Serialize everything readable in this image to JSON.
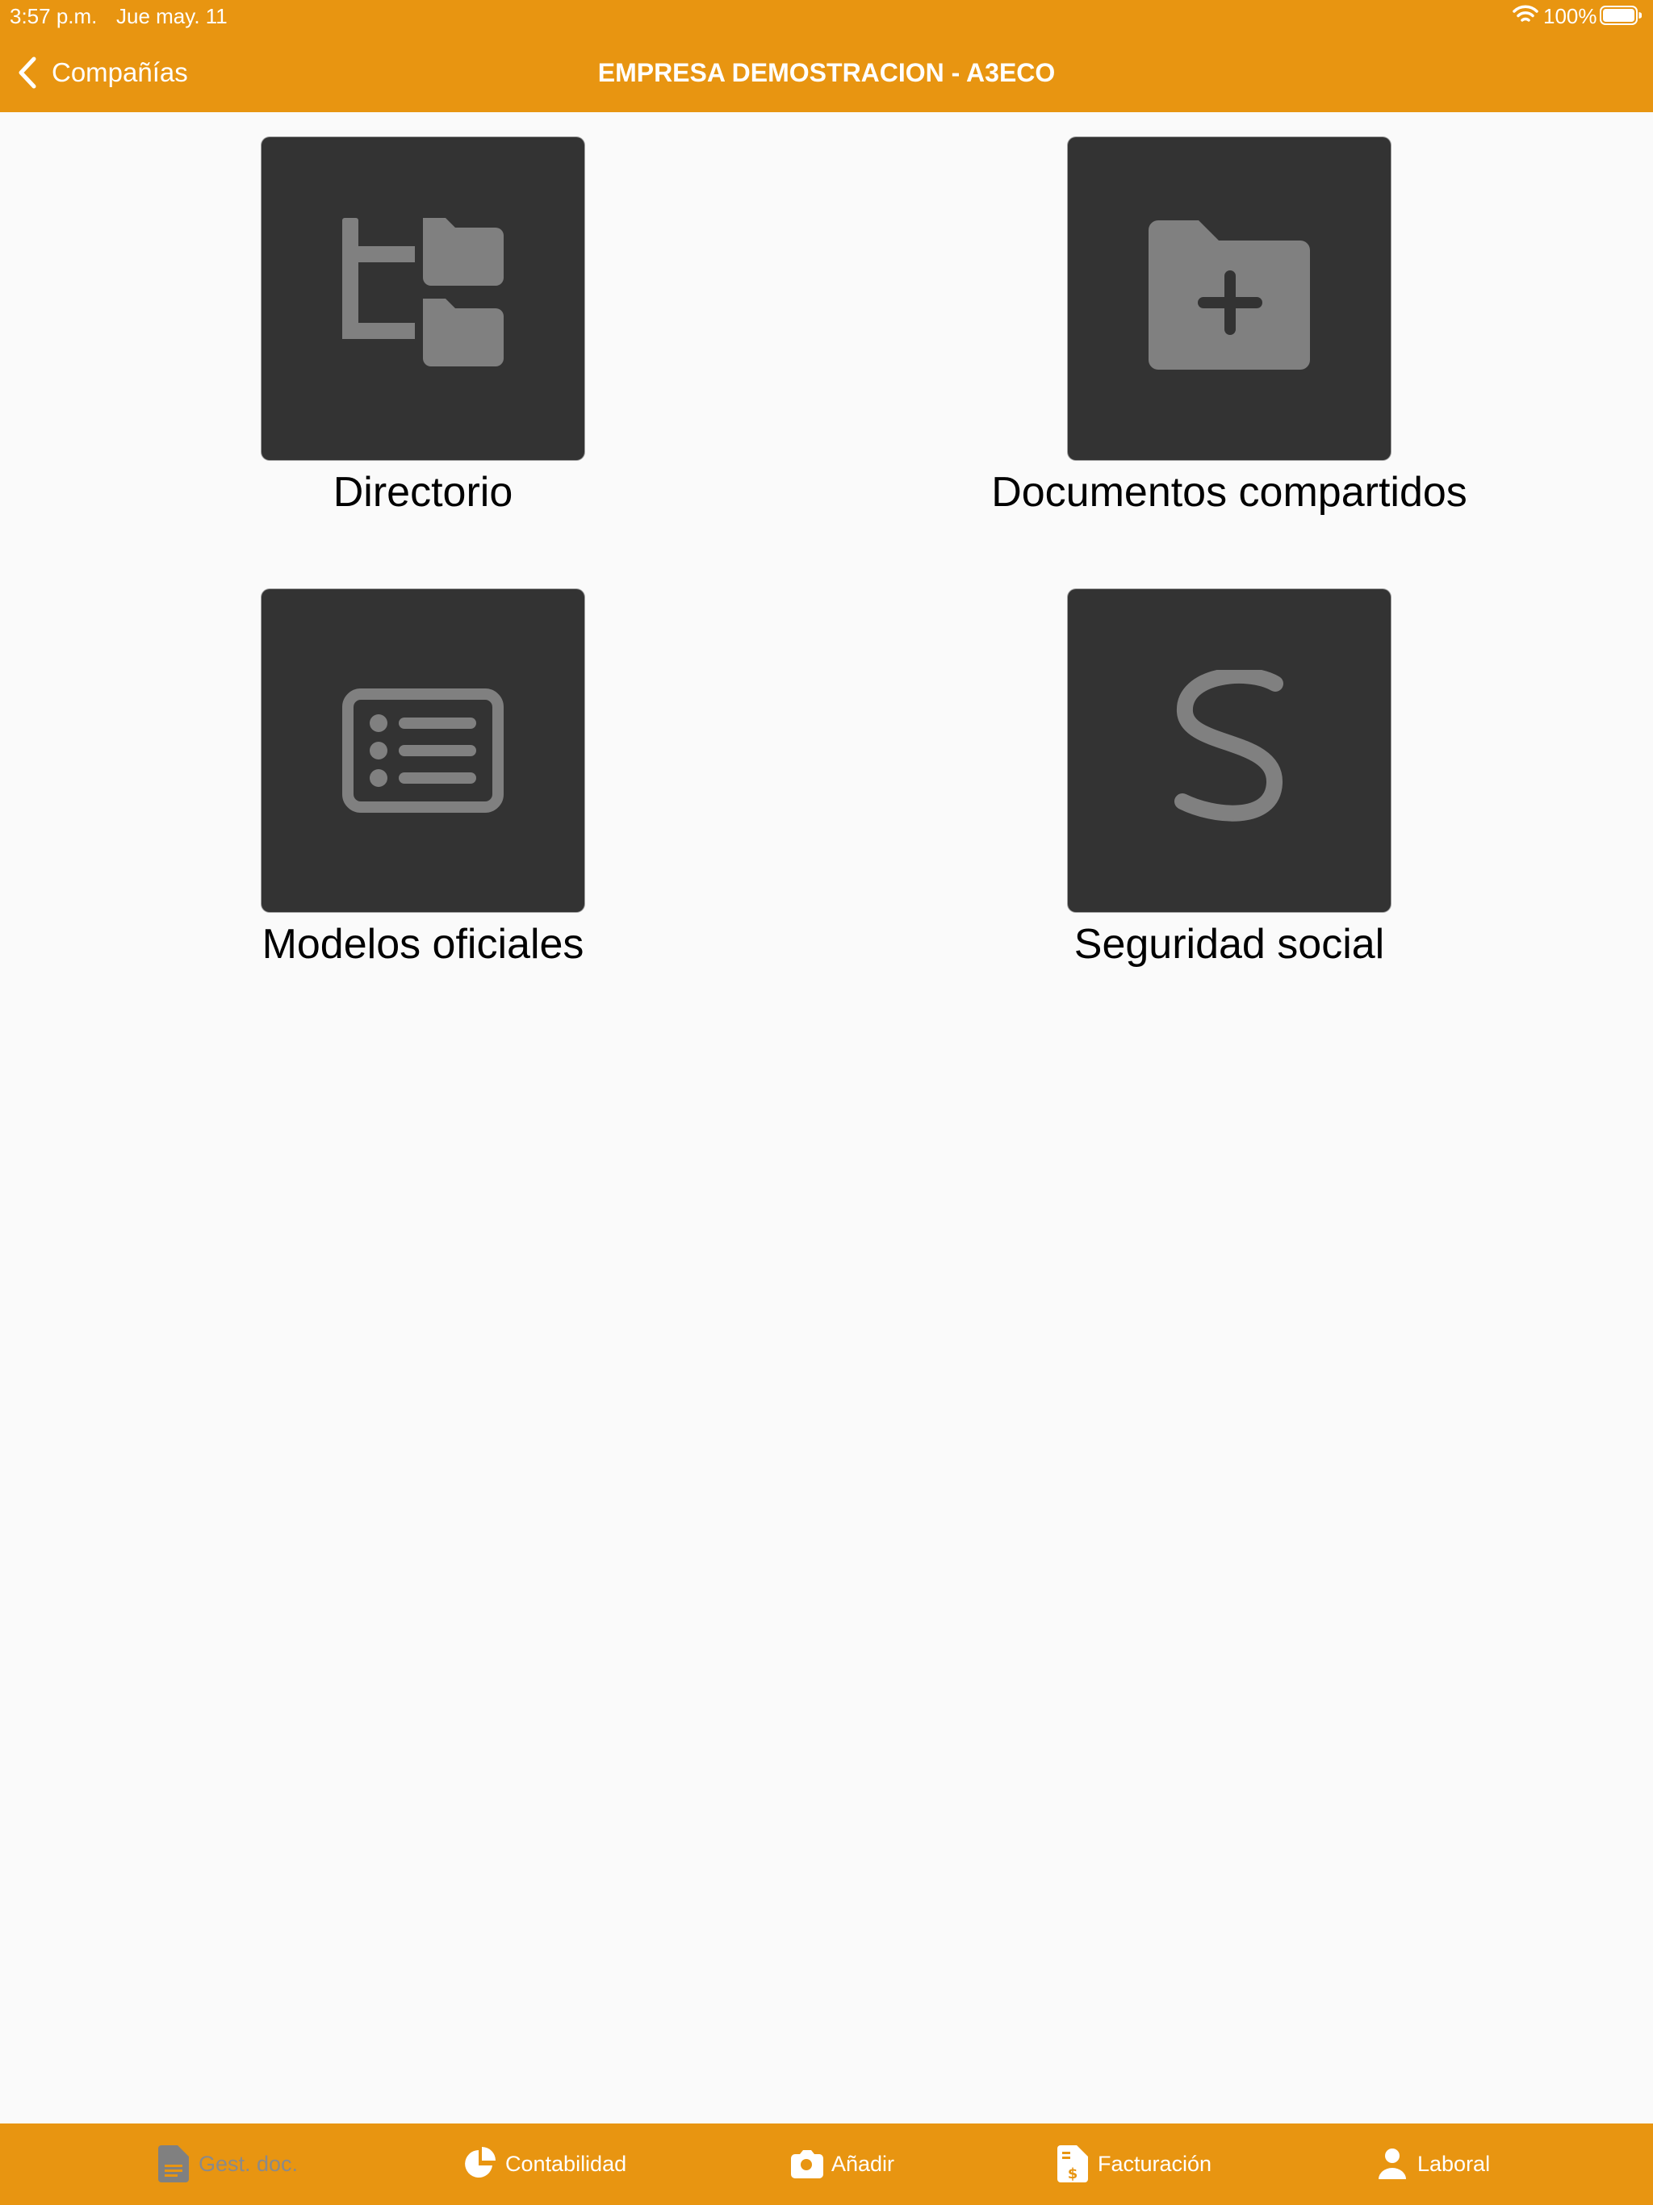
{
  "status_bar": {
    "time": "3:57 p.m.",
    "date": "Jue may. 11",
    "battery": "100%"
  },
  "nav": {
    "back_label": "Compañías",
    "title": "EMPRESA DEMOSTRACION - A3ECO"
  },
  "tiles": [
    {
      "label": "Directorio",
      "icon": "folder-tree-icon"
    },
    {
      "label": "Documentos compartidos",
      "icon": "folder-plus-icon"
    },
    {
      "label": "Modelos oficiales",
      "icon": "list-card-icon"
    },
    {
      "label": "Seguridad social",
      "icon": "letter-s-icon"
    }
  ],
  "tab_bar": {
    "tabs": [
      {
        "label": "Gest. doc.",
        "icon": "document-icon",
        "state": "inactive"
      },
      {
        "label": "Contabilidad",
        "icon": "pie-chart-icon",
        "state": "active"
      },
      {
        "label": "Añadir",
        "icon": "camera-icon",
        "state": "active"
      },
      {
        "label": "Facturación",
        "icon": "invoice-icon",
        "state": "active"
      },
      {
        "label": "Laboral",
        "icon": "person-icon",
        "state": "active"
      }
    ]
  },
  "colors": {
    "accent": "#e89511",
    "tile_background": "#333333",
    "icon_gray": "#808080",
    "inactive_tab": "#8a8a8a",
    "background": "#fafafa"
  }
}
